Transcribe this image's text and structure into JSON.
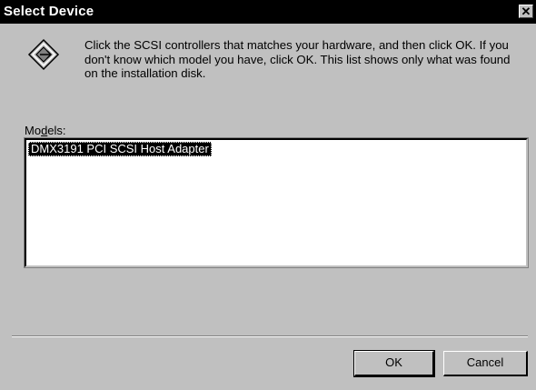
{
  "window": {
    "title": "Select Device",
    "close_label": "✕"
  },
  "message": {
    "icon": "disk-install-icon",
    "text": "Click the SCSI controllers that matches your hardware, and then click OK. If you don't know which model you have, click OK. This list shows only what was found on the installation disk."
  },
  "models": {
    "label_prefix": "Mo",
    "label_accel": "d",
    "label_suffix": "els:",
    "items": [
      "DMX3191 PCI SCSI Host Adapter"
    ],
    "selected_index": 0
  },
  "buttons": {
    "ok": "OK",
    "cancel": "Cancel"
  }
}
